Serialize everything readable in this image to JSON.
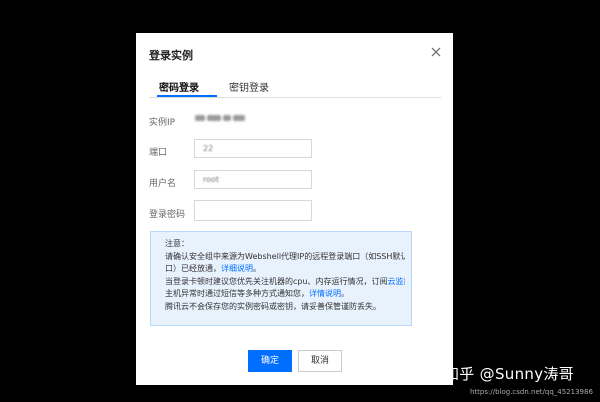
{
  "dialog": {
    "title": "登录实例",
    "tabs": [
      {
        "label": "密码登录",
        "active": true
      },
      {
        "label": "密钥登录",
        "active": false
      }
    ],
    "fields": {
      "ip_label": "实例IP",
      "port_label": "端口",
      "port_value": "22",
      "username_label": "用户名",
      "username_value": "root",
      "password_label": "登录密码",
      "password_value": ""
    },
    "notice": {
      "heading": "注意：",
      "line1": "请确认安全组中来源为Webshell代理IP的远程登录端口（如SSH默认22端",
      "line2a": "口）已经放通，",
      "line2_link": "详细说明",
      "line2b": "。",
      "line3a": "当登录卡顿时建议您优先关注机器的cpu、内存运行情况，订阅",
      "line3_link": "云监控",
      "line3b": "在",
      "line4a": "主机异常时通过短信等多种方式通知您，",
      "line4_link": "详情说明",
      "line4b": "。",
      "line5": "腾讯云不会保存您的实例密码或密钥，请妥善保管谨防丢失。"
    },
    "buttons": {
      "ok": "确定",
      "cancel": "取消"
    }
  },
  "watermark": {
    "text": "知乎 @Sunny涛哥",
    "url": "https://blog.csdn.net/qq_45213986"
  },
  "colors": {
    "accent": "#006eff",
    "notice_bg": "#e8f2fd",
    "overlay": "#000000"
  },
  "icons": {
    "close": "close-icon"
  }
}
